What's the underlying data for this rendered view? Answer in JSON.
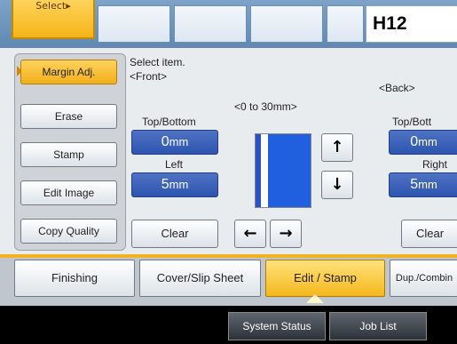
{
  "top_bar": {
    "select_label": "Select▸",
    "screen_id": "H12"
  },
  "left_menu": {
    "items": [
      {
        "label": "Margin Adj.",
        "active": true
      },
      {
        "label": "Erase",
        "active": false
      },
      {
        "label": "Stamp",
        "active": false
      },
      {
        "label": "Edit Image",
        "active": false
      },
      {
        "label": "Copy Quality",
        "active": false
      }
    ]
  },
  "main": {
    "instruction": "Select item.",
    "front_label": "<Front>",
    "back_label": "<Back>",
    "range_label": "<0 to 30mm>",
    "front": {
      "top_bottom_label": "Top/Bottom",
      "top_bottom_value": "0",
      "left_label": "Left",
      "left_value": "5",
      "unit": "mm",
      "clear_label": "Clear"
    },
    "back": {
      "top_bottom_label": "Top/Bott",
      "top_bottom_value": "0",
      "right_label": "Right",
      "right_value": "5",
      "unit": "mm",
      "clear_label": "Clear"
    },
    "arrows": {
      "up": "↑",
      "down": "↓",
      "left": "←",
      "right": "→"
    }
  },
  "tabs": [
    {
      "label": "Finishing",
      "active": false
    },
    {
      "label": "Cover/Slip Sheet",
      "active": false
    },
    {
      "label": "Edit / Stamp",
      "active": true
    },
    {
      "label": "Dup./Combin",
      "active": false
    }
  ],
  "status_bar": {
    "system_status": "System Status",
    "job_list": "Job List"
  },
  "colors": {
    "accent": "#f5b418",
    "value_box": "#2d55b0",
    "page_preview": "#1f5fe0"
  }
}
